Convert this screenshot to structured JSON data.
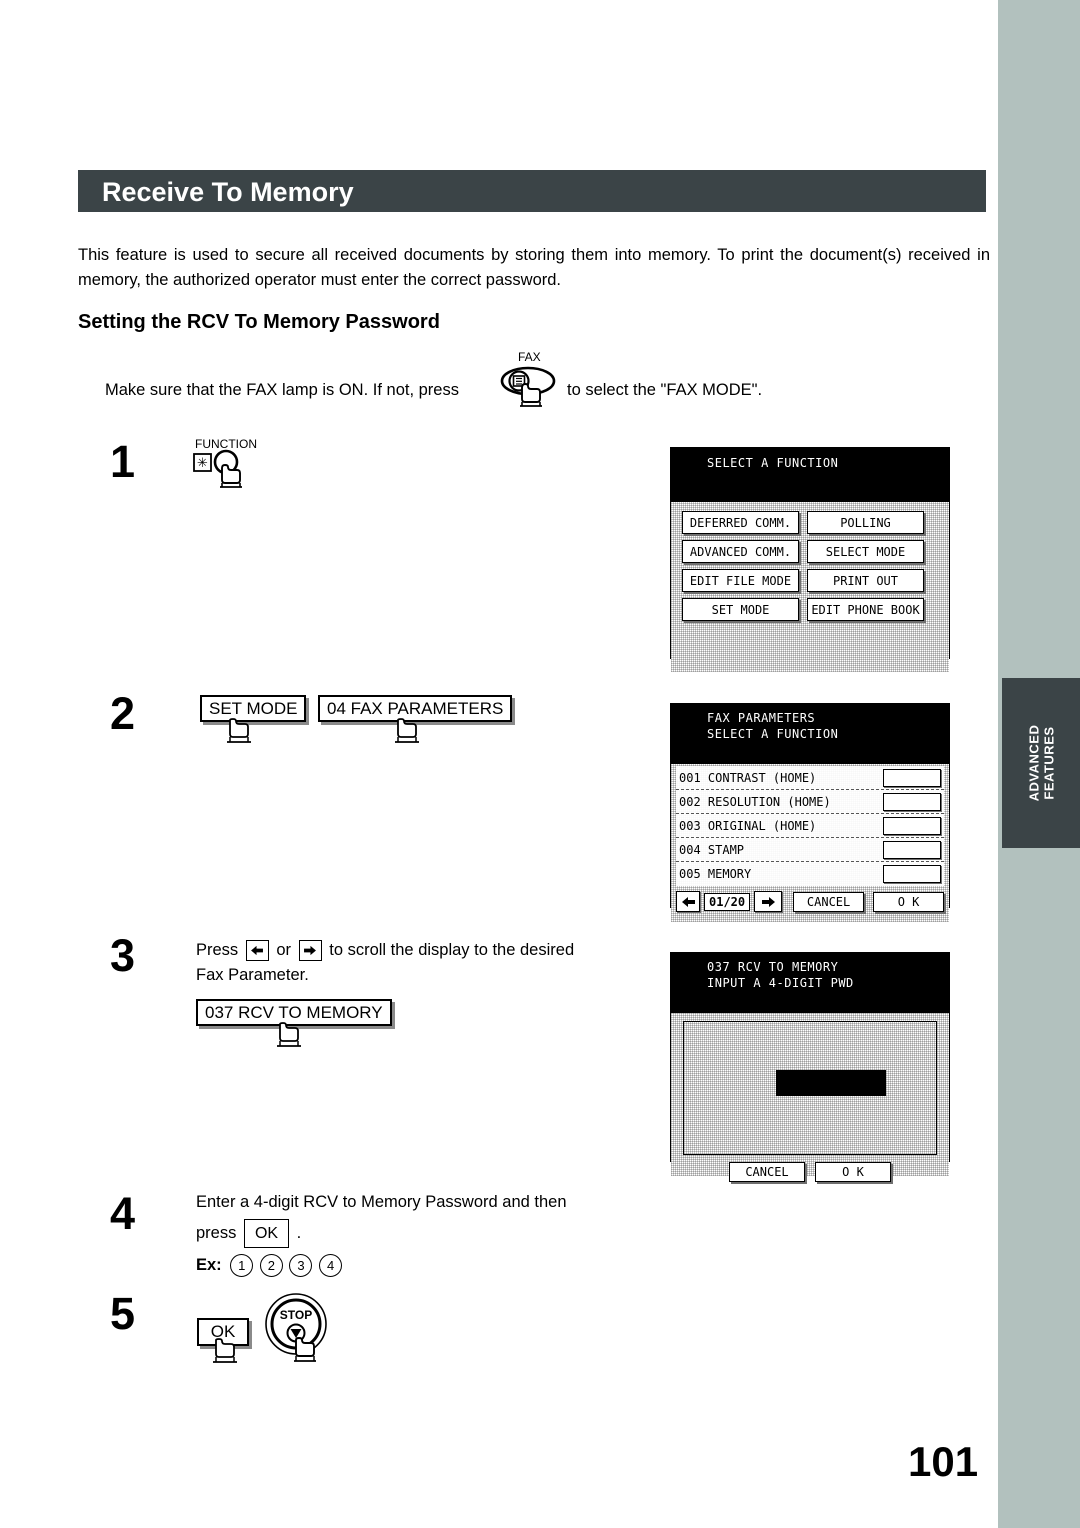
{
  "page": {
    "number": "101",
    "side_tab": "ADVANCED\nFEATURES",
    "side_tab_line1": "ADVANCED",
    "side_tab_line2": "FEATURES",
    "accent_dark": "#3b4447",
    "accent_band": "#b2c1be"
  },
  "header": {
    "title": "Receive To Memory"
  },
  "intro": {
    "paragraph": "This feature is used to secure all received documents by storing them into memory.  To print the document(s) received in memory, the authorized operator must enter the correct password."
  },
  "section": {
    "heading": "Setting the RCV To Memory Password",
    "fax_line_before": "Make sure that the FAX lamp is ON.  If not, press",
    "fax_line_after": "to select the \"FAX MODE\".",
    "fax_button_label": "FAX"
  },
  "steps": [
    {
      "number": "1",
      "key_label": "FUNCTION",
      "key_glyph": "✳"
    },
    {
      "number": "2",
      "buttons": [
        "SET MODE",
        "04 FAX PARAMETERS"
      ]
    },
    {
      "number": "3",
      "text_before": "Press",
      "text_middle": "or",
      "text_after": "to scroll the display to the desired",
      "text_line2": "Fax Parameter.",
      "button": "037 RCV TO MEMORY"
    },
    {
      "number": "4",
      "line1": "Enter a 4-digit RCV to Memory Password and then",
      "line2_before": "press",
      "line2_button": "OK",
      "line2_after": ".",
      "example_label": "Ex:",
      "example_digits": [
        "1",
        "2",
        "3",
        "4"
      ]
    },
    {
      "number": "5",
      "buttons": [
        "OK",
        "STOP"
      ]
    }
  ],
  "lcd1": {
    "header": "SELECT A FUNCTION",
    "buttons": [
      "DEFERRED COMM.",
      "POLLING",
      "ADVANCED COMM.",
      "SELECT MODE",
      "EDIT FILE MODE",
      "PRINT OUT",
      "SET MODE",
      "EDIT PHONE BOOK"
    ]
  },
  "lcd2": {
    "header_line1": "FAX PARAMETERS",
    "header_line2": "SELECT A FUNCTION",
    "rows": [
      "001 CONTRAST (HOME)",
      "002 RESOLUTION (HOME)",
      "003 ORIGINAL (HOME)",
      "004 STAMP",
      "005 MEMORY"
    ],
    "page_indicator": "01/20",
    "cancel": "CANCEL",
    "ok": "O K"
  },
  "lcd3": {
    "header_line1": "037 RCV TO MEMORY",
    "header_line2": "INPUT A 4-DIGIT PWD",
    "cancel": "CANCEL",
    "ok": "O K"
  }
}
